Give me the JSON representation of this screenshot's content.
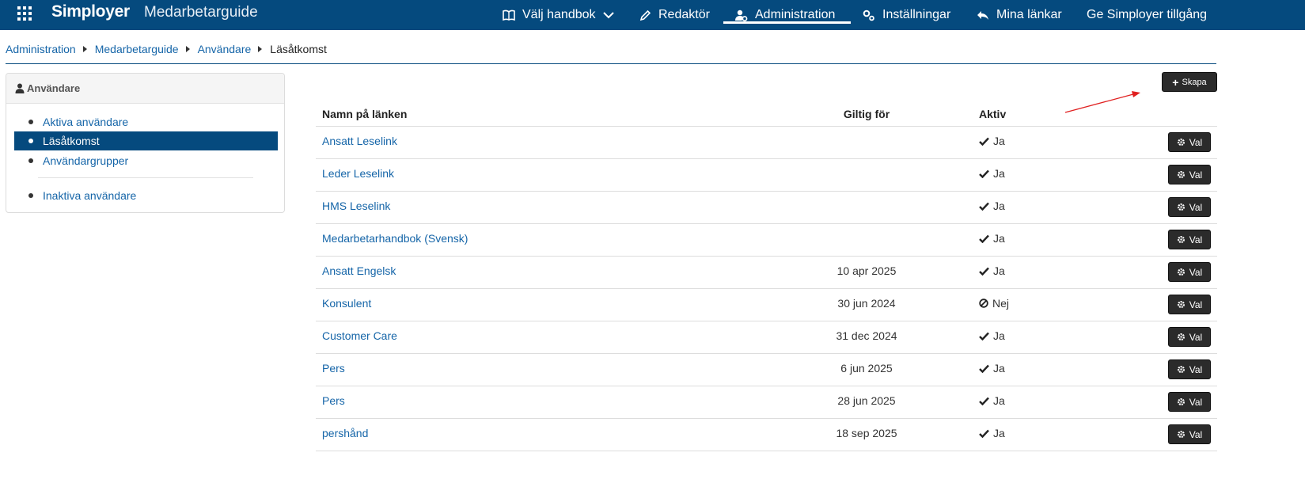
{
  "header": {
    "brand": "Simployer",
    "product": "Medarbetarguide",
    "nav": [
      {
        "label": "Välj handbok",
        "icon": "book-icon"
      },
      {
        "label": "Redaktör",
        "icon": "pencil-icon"
      },
      {
        "label": "Administration",
        "icon": "user-cog-icon"
      },
      {
        "label": "Inställningar",
        "icon": "gears-icon"
      },
      {
        "label": "Mina länkar",
        "icon": "reply-icon"
      },
      {
        "label": "Ge Simployer tillgång",
        "icon": ""
      }
    ]
  },
  "breadcrumb": {
    "items": [
      "Administration",
      "Medarbetarguide",
      "Användare"
    ],
    "current": "Läsåtkomst"
  },
  "sidebar": {
    "title": "Användare",
    "items": [
      {
        "label": "Aktiva användare"
      },
      {
        "label": "Läsåtkomst"
      },
      {
        "label": "Användargrupper"
      },
      {
        "label": "Inaktiva användare"
      }
    ]
  },
  "toolbar": {
    "create_label": "Skapa"
  },
  "table": {
    "headers": {
      "name": "Namn på länken",
      "valid": "Giltig för",
      "active": "Aktiv"
    },
    "action_label": "Val",
    "rows": [
      {
        "name": "Ansatt Leselink",
        "valid": "",
        "active": "Ja",
        "status": "check"
      },
      {
        "name": "Leder Leselink",
        "valid": "",
        "active": "Ja",
        "status": "check"
      },
      {
        "name": "HMS Leselink",
        "valid": "",
        "active": "Ja",
        "status": "check"
      },
      {
        "name": "Medarbetarhandbok (Svensk)",
        "valid": "",
        "active": "Ja",
        "status": "check"
      },
      {
        "name": "Ansatt Engelsk",
        "valid": "10 apr 2025",
        "active": "Ja",
        "status": "check"
      },
      {
        "name": "Konsulent",
        "valid": "30 jun 2024",
        "active": "Nej",
        "status": "ban"
      },
      {
        "name": "Customer Care",
        "valid": "31 dec 2024",
        "active": "Ja",
        "status": "check"
      },
      {
        "name": "Pers",
        "valid": "6 jun 2025",
        "active": "Ja",
        "status": "check"
      },
      {
        "name": "Pers",
        "valid": "28 jun 2025",
        "active": "Ja",
        "status": "check"
      },
      {
        "name": "pershånd",
        "valid": "18 sep 2025",
        "active": "Ja",
        "status": "check"
      }
    ]
  },
  "colors": {
    "header_bg": "#054a7e",
    "link": "#1565a8",
    "button_bg": "#2b2b2b",
    "annotation_arrow": "#e02020"
  }
}
